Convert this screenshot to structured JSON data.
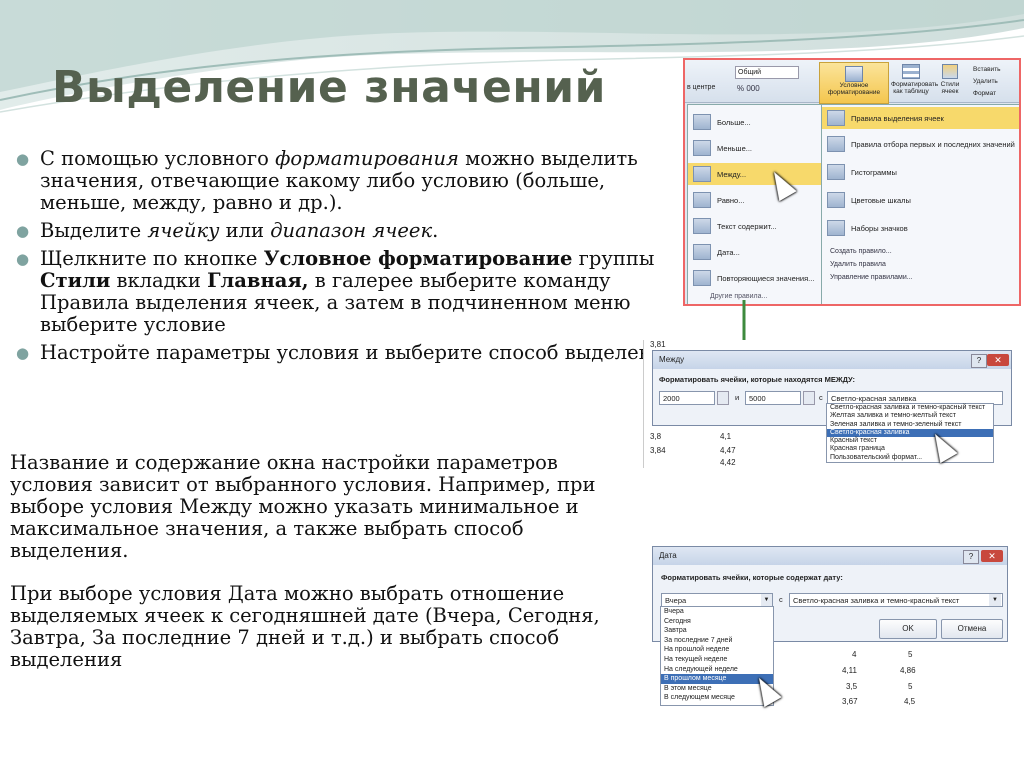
{
  "title": "Выделение значений",
  "bullets": [
    {
      "pre": "С помощью условного ",
      "em": "форматирования",
      "post": " можно выделить значения, отвечающие какому либо условию (больше, меньше, между, равно и др.)."
    },
    {
      "pre": "Выделите ",
      "em": "ячейку",
      "mid": " или ",
      "em2": "диапазон ячеек",
      "post": "."
    },
    {
      "pre": "Щелкните по кнопке ",
      "b1": "Условное форматирование",
      "mid": " группы ",
      "b2": "Стили",
      "mid2": " вкладки ",
      "b3": "Главная,",
      "post": " в галерее выберите команду Правила выделения ячеек, а затем в подчиненном меню выберите условие"
    },
    {
      "text": "Настройте параметры условия и выберите способ выделения"
    }
  ],
  "para1": "Название и содержание окна настройки параметров условия зависит от выбранного условия. Например, при выборе условия Между можно указать минимальное и максимальное значения, а также выбрать способ выделения.",
  "para2": "При выборе условия Дата можно выбрать отношение выделяемых ячеек к сегодняшней дате (Вчера, Сегодня, Завтра, За последние 7 дней и т.д.) и выбрать способ выделения",
  "ribbon": {
    "align_label": "в центре",
    "number_format": "Общий",
    "cond_format": "Условное форматирование",
    "format_table": "Форматировать как таблицу",
    "cell_styles": "Стили ячеек",
    "insert": "Вставить",
    "delete": "Удалить",
    "format": "Формат",
    "left_menu": [
      "Больше...",
      "Меньше...",
      "Между...",
      "Равно...",
      "Текст содержит...",
      "Дата...",
      "Повторяющиеся значения..."
    ],
    "left_more": "Другие правила...",
    "right_menu": [
      "Правила выделения ячеек",
      "Правила отбора первых и последних значений",
      "Гистограммы",
      "Цветовые шкалы",
      "Наборы значков"
    ],
    "right_small": [
      "Создать правило...",
      "Удалить правила",
      "Управление правилами..."
    ]
  },
  "between_dialog": {
    "title": "Между",
    "prompt": "Форматировать ячейки, которые находятся МЕЖДУ:",
    "min": "2000",
    "and": "и",
    "max": "5000",
    "with": "с",
    "style": "Светло-красная заливка",
    "options": [
      "Светло-красная заливка и темно-красный текст",
      "Желтая заливка и темно-желтый текст",
      "Зеленая заливка и темно-зеленый текст",
      "Светло-красная заливка",
      "Красный текст",
      "Красная граница",
      "Пользовательский формат..."
    ],
    "cells": [
      "3,81",
      "3,8",
      "4,1",
      "3,84",
      "4,47",
      "4,42"
    ]
  },
  "date_dialog": {
    "title": "Дата",
    "prompt": "Форматировать ячейки, которые содержат дату:",
    "selected": "Вчера",
    "with": "с",
    "style": "Светло-красная заливка и темно-красный текст",
    "ok": "OK",
    "cancel": "Отмена",
    "options": [
      "Вчера",
      "Сегодня",
      "Завтра",
      "За последние 7 дней",
      "На прошлой неделе",
      "На текущей неделе",
      "На следующей неделе",
      "В прошлом месяце",
      "В этом месяце",
      "В следующем месяце"
    ],
    "cells": [
      [
        "4",
        "5"
      ],
      [
        "4,11",
        "4,86"
      ],
      [
        "3,5",
        "5"
      ],
      [
        "3,67",
        "4,5"
      ]
    ]
  }
}
